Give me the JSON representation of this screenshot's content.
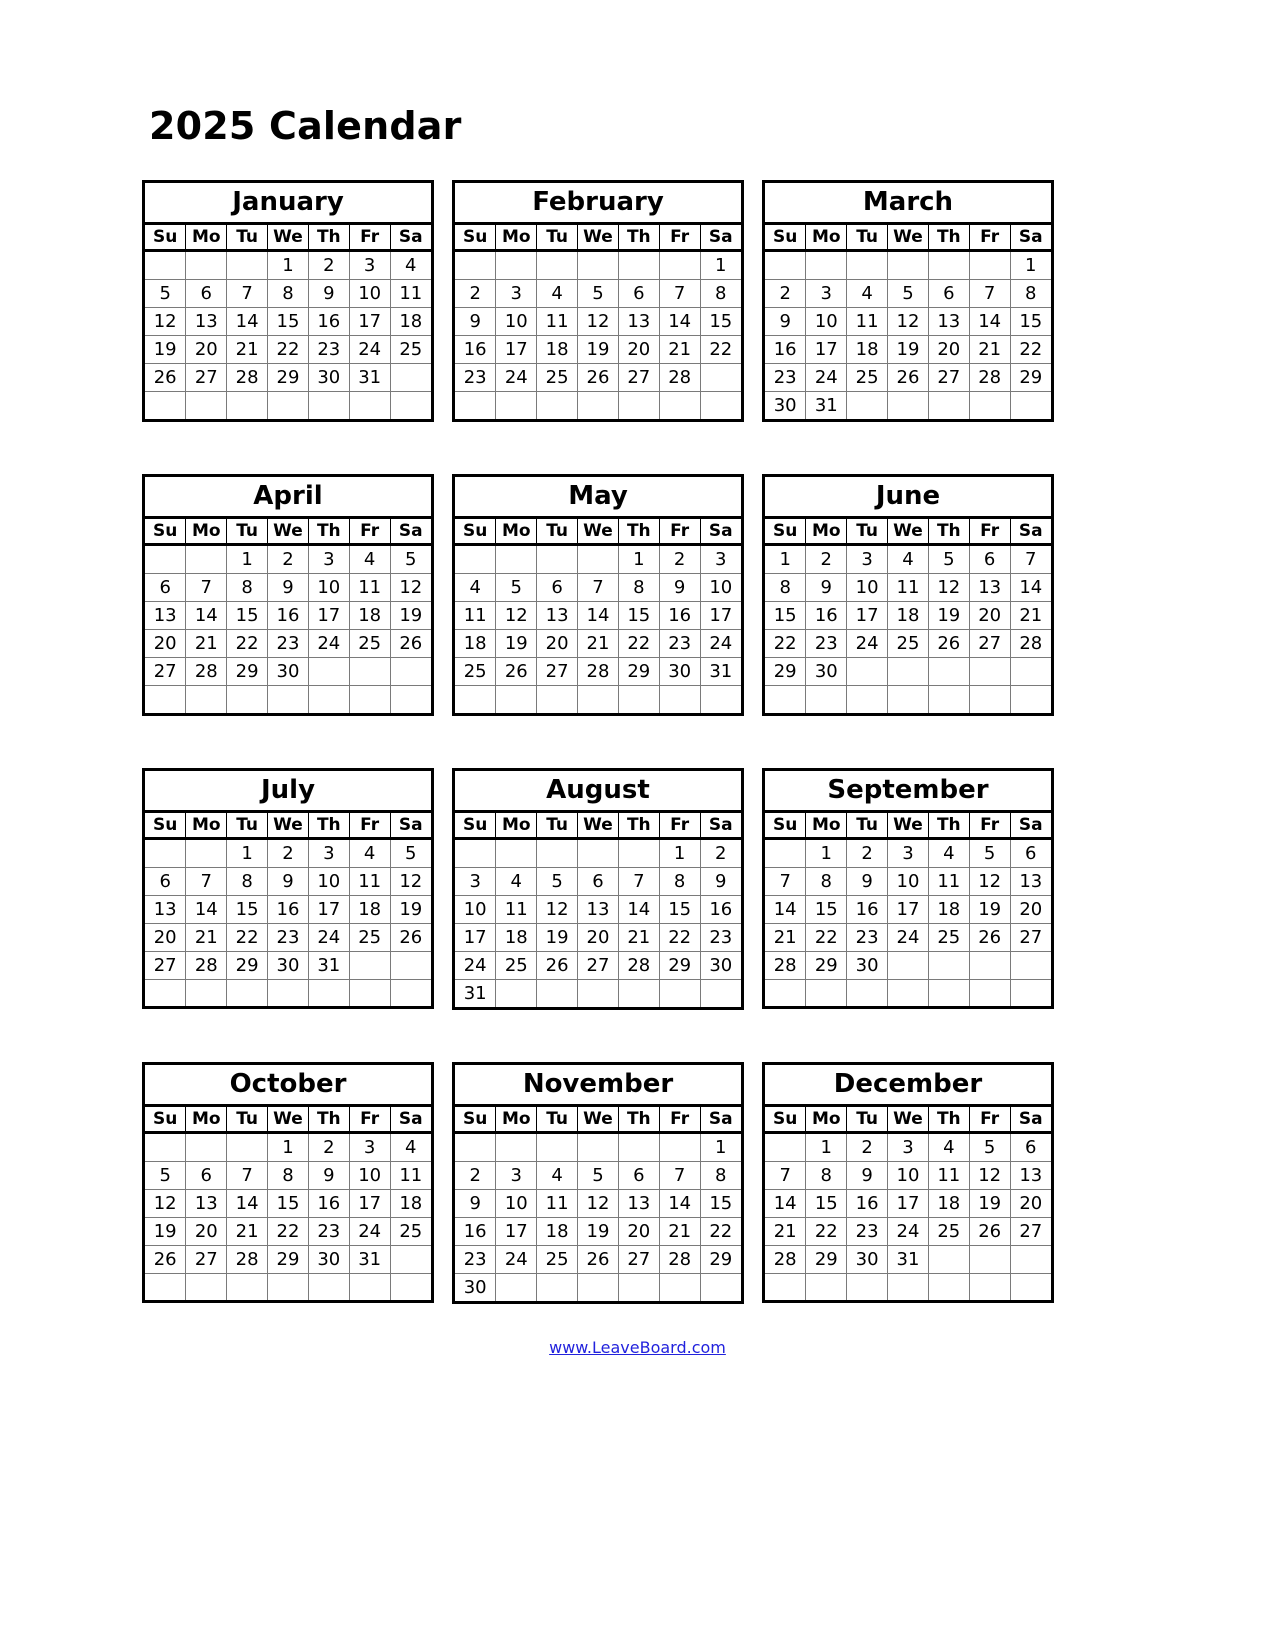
{
  "title": "2025 Calendar",
  "footer": {
    "link_text": "www.LeaveBoard.com",
    "link_color": "#2222dd"
  },
  "weekday_headers": [
    "Su",
    "Mo",
    "Tu",
    "We",
    "Th",
    "Fr",
    "Sa"
  ],
  "chart_data": {
    "type": "table",
    "title": "2025 Calendar",
    "year": 2025,
    "first_weekday": "Sunday",
    "months": [
      {
        "name": "January",
        "days_in_month": 31,
        "start_weekday_index": 3,
        "weeks": [
          [
            "",
            "",
            "",
            "1",
            "2",
            "3",
            "4"
          ],
          [
            "5",
            "6",
            "7",
            "8",
            "9",
            "10",
            "11"
          ],
          [
            "12",
            "13",
            "14",
            "15",
            "16",
            "17",
            "18"
          ],
          [
            "19",
            "20",
            "21",
            "22",
            "23",
            "24",
            "25"
          ],
          [
            "26",
            "27",
            "28",
            "29",
            "30",
            "31",
            ""
          ],
          [
            "",
            "",
            "",
            "",
            "",
            "",
            ""
          ]
        ]
      },
      {
        "name": "February",
        "days_in_month": 28,
        "start_weekday_index": 6,
        "weeks": [
          [
            "",
            "",
            "",
            "",
            "",
            "",
            "1"
          ],
          [
            "2",
            "3",
            "4",
            "5",
            "6",
            "7",
            "8"
          ],
          [
            "9",
            "10",
            "11",
            "12",
            "13",
            "14",
            "15"
          ],
          [
            "16",
            "17",
            "18",
            "19",
            "20",
            "21",
            "22"
          ],
          [
            "23",
            "24",
            "25",
            "26",
            "27",
            "28",
            ""
          ],
          [
            "",
            "",
            "",
            "",
            "",
            "",
            ""
          ]
        ]
      },
      {
        "name": "March",
        "days_in_month": 31,
        "start_weekday_index": 6,
        "weeks": [
          [
            "",
            "",
            "",
            "",
            "",
            "",
            "1"
          ],
          [
            "2",
            "3",
            "4",
            "5",
            "6",
            "7",
            "8"
          ],
          [
            "9",
            "10",
            "11",
            "12",
            "13",
            "14",
            "15"
          ],
          [
            "16",
            "17",
            "18",
            "19",
            "20",
            "21",
            "22"
          ],
          [
            "23",
            "24",
            "25",
            "26",
            "27",
            "28",
            "29"
          ],
          [
            "30",
            "31",
            "",
            "",
            "",
            "",
            ""
          ]
        ]
      },
      {
        "name": "April",
        "days_in_month": 30,
        "start_weekday_index": 2,
        "weeks": [
          [
            "",
            "",
            "1",
            "2",
            "3",
            "4",
            "5"
          ],
          [
            "6",
            "7",
            "8",
            "9",
            "10",
            "11",
            "12"
          ],
          [
            "13",
            "14",
            "15",
            "16",
            "17",
            "18",
            "19"
          ],
          [
            "20",
            "21",
            "22",
            "23",
            "24",
            "25",
            "26"
          ],
          [
            "27",
            "28",
            "29",
            "30",
            "",
            "",
            ""
          ],
          [
            "",
            "",
            "",
            "",
            "",
            "",
            ""
          ]
        ]
      },
      {
        "name": "May",
        "days_in_month": 31,
        "start_weekday_index": 4,
        "weeks": [
          [
            "",
            "",
            "",
            "",
            "1",
            "2",
            "3"
          ],
          [
            "4",
            "5",
            "6",
            "7",
            "8",
            "9",
            "10"
          ],
          [
            "11",
            "12",
            "13",
            "14",
            "15",
            "16",
            "17"
          ],
          [
            "18",
            "19",
            "20",
            "21",
            "22",
            "23",
            "24"
          ],
          [
            "25",
            "26",
            "27",
            "28",
            "29",
            "30",
            "31"
          ],
          [
            "",
            "",
            "",
            "",
            "",
            "",
            ""
          ]
        ]
      },
      {
        "name": "June",
        "days_in_month": 30,
        "start_weekday_index": 0,
        "weeks": [
          [
            "1",
            "2",
            "3",
            "4",
            "5",
            "6",
            "7"
          ],
          [
            "8",
            "9",
            "10",
            "11",
            "12",
            "13",
            "14"
          ],
          [
            "15",
            "16",
            "17",
            "18",
            "19",
            "20",
            "21"
          ],
          [
            "22",
            "23",
            "24",
            "25",
            "26",
            "27",
            "28"
          ],
          [
            "29",
            "30",
            "",
            "",
            "",
            "",
            ""
          ],
          [
            "",
            "",
            "",
            "",
            "",
            "",
            ""
          ]
        ]
      },
      {
        "name": "July",
        "days_in_month": 31,
        "start_weekday_index": 2,
        "weeks": [
          [
            "",
            "",
            "1",
            "2",
            "3",
            "4",
            "5"
          ],
          [
            "6",
            "7",
            "8",
            "9",
            "10",
            "11",
            "12"
          ],
          [
            "13",
            "14",
            "15",
            "16",
            "17",
            "18",
            "19"
          ],
          [
            "20",
            "21",
            "22",
            "23",
            "24",
            "25",
            "26"
          ],
          [
            "27",
            "28",
            "29",
            "30",
            "31",
            "",
            ""
          ],
          [
            "",
            "",
            "",
            "",
            "",
            "",
            ""
          ]
        ]
      },
      {
        "name": "August",
        "days_in_month": 31,
        "start_weekday_index": 5,
        "weeks": [
          [
            "",
            "",
            "",
            "",
            "",
            "1",
            "2"
          ],
          [
            "3",
            "4",
            "5",
            "6",
            "7",
            "8",
            "9"
          ],
          [
            "10",
            "11",
            "12",
            "13",
            "14",
            "15",
            "16"
          ],
          [
            "17",
            "18",
            "19",
            "20",
            "21",
            "22",
            "23"
          ],
          [
            "24",
            "25",
            "26",
            "27",
            "28",
            "29",
            "30"
          ],
          [
            "31",
            "",
            "",
            "",
            "",
            "",
            ""
          ]
        ]
      },
      {
        "name": "September",
        "days_in_month": 30,
        "start_weekday_index": 1,
        "weeks": [
          [
            "",
            "1",
            "2",
            "3",
            "4",
            "5",
            "6"
          ],
          [
            "7",
            "8",
            "9",
            "10",
            "11",
            "12",
            "13"
          ],
          [
            "14",
            "15",
            "16",
            "17",
            "18",
            "19",
            "20"
          ],
          [
            "21",
            "22",
            "23",
            "24",
            "25",
            "26",
            "27"
          ],
          [
            "28",
            "29",
            "30",
            "",
            "",
            "",
            ""
          ],
          [
            "",
            "",
            "",
            "",
            "",
            "",
            ""
          ]
        ]
      },
      {
        "name": "October",
        "days_in_month": 31,
        "start_weekday_index": 3,
        "weeks": [
          [
            "",
            "",
            "",
            "1",
            "2",
            "3",
            "4"
          ],
          [
            "5",
            "6",
            "7",
            "8",
            "9",
            "10",
            "11"
          ],
          [
            "12",
            "13",
            "14",
            "15",
            "16",
            "17",
            "18"
          ],
          [
            "19",
            "20",
            "21",
            "22",
            "23",
            "24",
            "25"
          ],
          [
            "26",
            "27",
            "28",
            "29",
            "30",
            "31",
            ""
          ],
          [
            "",
            "",
            "",
            "",
            "",
            "",
            ""
          ]
        ]
      },
      {
        "name": "November",
        "days_in_month": 30,
        "start_weekday_index": 6,
        "weeks": [
          [
            "",
            "",
            "",
            "",
            "",
            "",
            "1"
          ],
          [
            "2",
            "3",
            "4",
            "5",
            "6",
            "7",
            "8"
          ],
          [
            "9",
            "10",
            "11",
            "12",
            "13",
            "14",
            "15"
          ],
          [
            "16",
            "17",
            "18",
            "19",
            "20",
            "21",
            "22"
          ],
          [
            "23",
            "24",
            "25",
            "26",
            "27",
            "28",
            "29"
          ],
          [
            "30",
            "",
            "",
            "",
            "",
            "",
            ""
          ]
        ]
      },
      {
        "name": "December",
        "days_in_month": 31,
        "start_weekday_index": 1,
        "weeks": [
          [
            "",
            "1",
            "2",
            "3",
            "4",
            "5",
            "6"
          ],
          [
            "7",
            "8",
            "9",
            "10",
            "11",
            "12",
            "13"
          ],
          [
            "14",
            "15",
            "16",
            "17",
            "18",
            "19",
            "20"
          ],
          [
            "21",
            "22",
            "23",
            "24",
            "25",
            "26",
            "27"
          ],
          [
            "28",
            "29",
            "30",
            "31",
            "",
            "",
            ""
          ],
          [
            "",
            "",
            "",
            "",
            "",
            "",
            ""
          ]
        ]
      }
    ]
  }
}
